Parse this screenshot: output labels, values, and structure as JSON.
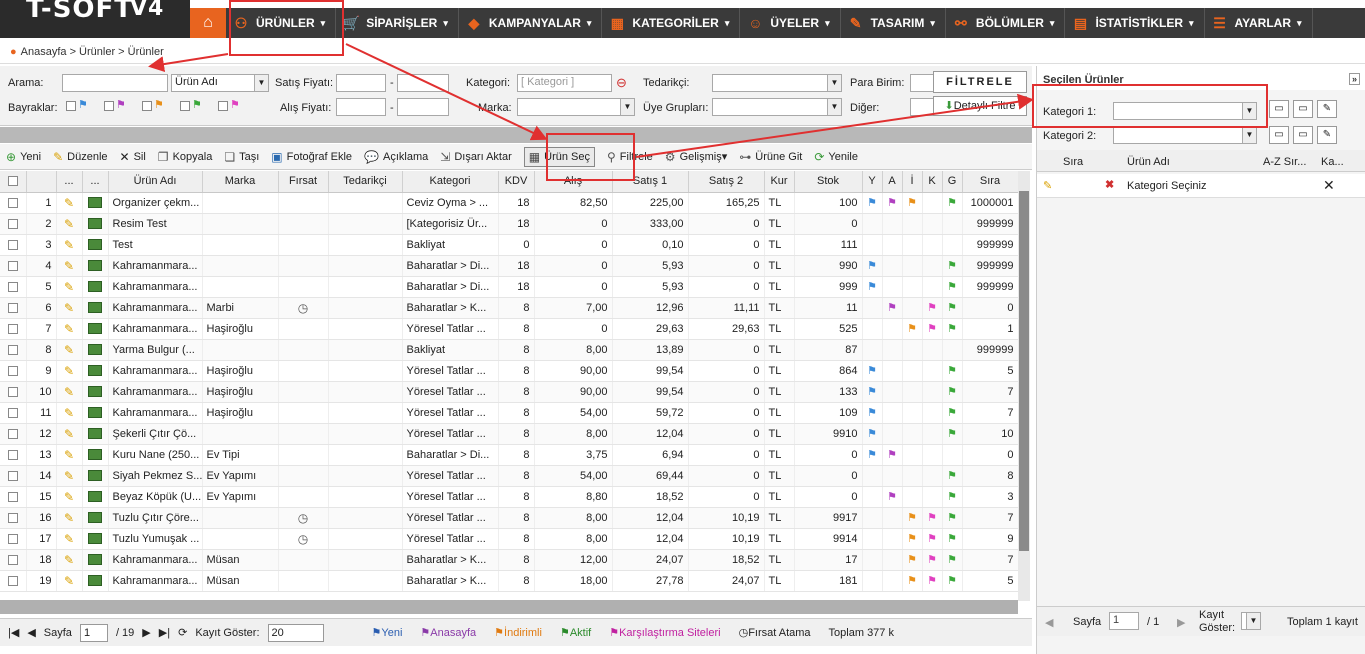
{
  "app": {
    "logo": "T-SOFT",
    "logo_version": "V4"
  },
  "menu": [
    {
      "label": "ÜRÜNLER",
      "icon": "product-icon"
    },
    {
      "label": "SİPARİŞLER",
      "icon": "cart-icon"
    },
    {
      "label": "KAMPANYALAR",
      "icon": "tag-icon"
    },
    {
      "label": "KATEGORİLER",
      "icon": "category-icon"
    },
    {
      "label": "ÜYELER",
      "icon": "users-icon"
    },
    {
      "label": "TASARIM",
      "icon": "design-icon"
    },
    {
      "label": "BÖLÜMLER",
      "icon": "sections-icon"
    },
    {
      "label": "İSTATİSTİKLER",
      "icon": "stats-icon"
    },
    {
      "label": "AYARLAR",
      "icon": "settings-icon"
    }
  ],
  "breadcrumb": "Anasayfa > Ürünler > Ürünler",
  "filters": {
    "arama": "Arama:",
    "urun_adi": "Ürün Adı",
    "satis_fiyati": "Satış Fiyatı:",
    "kategori": "Kategori:",
    "kategori_placeholder": "[ Kategori ]",
    "tedarikci": "Tedarikçi:",
    "para_birim": "Para Birim:",
    "filtrele": "FİLTRELE",
    "bayraklar": "Bayraklar:",
    "alis_fiyati": "Alış Fiyatı:",
    "marka": "Marka:",
    "uye_gruplari": "Üye Grupları:",
    "diger": "Diğer:",
    "detayli_filtre": "Detaylı Filtre",
    "dash": "-"
  },
  "toolbar": [
    "Yeni",
    "Düzenle",
    "Sil",
    "Kopyala",
    "Taşı",
    "Fotoğraf Ekle",
    "Açıklama",
    "Dışarı Aktar",
    "Ürün Seç",
    "Filtrele",
    "Gelişmiş",
    "Ürüne Git",
    "Yenile"
  ],
  "columns": [
    "...",
    "...",
    "Ürün Adı",
    "Marka",
    "Fırsat",
    "Tedarikçi",
    "Kategori",
    "KDV",
    "Alış",
    "Satış 1",
    "Satış 2",
    "Kur",
    "Stok",
    "Y",
    "A",
    "İ",
    "K",
    "G",
    "Sıra"
  ],
  "rows": [
    {
      "n": "1",
      "name": "Organizer çekm...",
      "brand": "",
      "firsat": false,
      "cat": "Ceviz Oyma > ...",
      "kdv": "18",
      "alis": "82,50",
      "s1": "225,00",
      "s2": "165,25",
      "kur": "TL",
      "stok": "100",
      "flags": [
        "Y",
        "A",
        "İ",
        "G"
      ],
      "sira": "1000001"
    },
    {
      "n": "2",
      "name": "Resim Test",
      "brand": "",
      "firsat": false,
      "cat": "[Kategorisiz Ür...",
      "kdv": "18",
      "alis": "0",
      "s1": "333,00",
      "s2": "0",
      "kur": "TL",
      "stok": "0",
      "flags": [],
      "sira": "999999"
    },
    {
      "n": "3",
      "name": "Test",
      "brand": "",
      "firsat": false,
      "cat": "Bakliyat",
      "kdv": "0",
      "alis": "0",
      "s1": "0,10",
      "s2": "0",
      "kur": "TL",
      "stok": "111",
      "flags": [],
      "sira": "999999"
    },
    {
      "n": "4",
      "name": "Kahramanmara...",
      "brand": "",
      "firsat": false,
      "cat": "Baharatlar > Di...",
      "kdv": "18",
      "alis": "0",
      "s1": "5,93",
      "s2": "0",
      "kur": "TL",
      "stok": "990",
      "flags": [
        "Y",
        "G"
      ],
      "sira": "999999"
    },
    {
      "n": "5",
      "name": "Kahramanmara...",
      "brand": "",
      "firsat": false,
      "cat": "Baharatlar > Di...",
      "kdv": "18",
      "alis": "0",
      "s1": "5,93",
      "s2": "0",
      "kur": "TL",
      "stok": "999",
      "flags": [
        "Y",
        "G"
      ],
      "sira": "999999"
    },
    {
      "n": "6",
      "name": "Kahramanmara...",
      "brand": "Marbi",
      "firsat": true,
      "cat": "Baharatlar > K...",
      "kdv": "8",
      "alis": "7,00",
      "s1": "12,96",
      "s2": "11,11",
      "kur": "TL",
      "stok": "11",
      "flags": [
        "A",
        "K",
        "G"
      ],
      "sira": "0"
    },
    {
      "n": "7",
      "name": "Kahramanmara...",
      "brand": "Haşiroğlu",
      "firsat": false,
      "cat": "Yöresel Tatlar ...",
      "kdv": "8",
      "alis": "0",
      "s1": "29,63",
      "s2": "29,63",
      "kur": "TL",
      "stok": "525",
      "flags": [
        "İ",
        "K",
        "G"
      ],
      "sira": "1"
    },
    {
      "n": "8",
      "name": "Yarma Bulgur (...",
      "brand": "",
      "firsat": false,
      "cat": "Bakliyat",
      "kdv": "8",
      "alis": "8,00",
      "s1": "13,89",
      "s2": "0",
      "kur": "TL",
      "stok": "87",
      "flags": [],
      "sira": "999999"
    },
    {
      "n": "9",
      "name": "Kahramanmara...",
      "brand": "Haşiroğlu",
      "firsat": false,
      "cat": "Yöresel Tatlar ...",
      "kdv": "8",
      "alis": "90,00",
      "s1": "99,54",
      "s2": "0",
      "kur": "TL",
      "stok": "864",
      "flags": [
        "Y",
        "G"
      ],
      "sira": "5"
    },
    {
      "n": "10",
      "name": "Kahramanmara...",
      "brand": "Haşiroğlu",
      "firsat": false,
      "cat": "Yöresel Tatlar ...",
      "kdv": "8",
      "alis": "90,00",
      "s1": "99,54",
      "s2": "0",
      "kur": "TL",
      "stok": "133",
      "flags": [
        "Y",
        "G"
      ],
      "sira": "7"
    },
    {
      "n": "11",
      "name": "Kahramanmara...",
      "brand": "Haşiroğlu",
      "firsat": false,
      "cat": "Yöresel Tatlar ...",
      "kdv": "8",
      "alis": "54,00",
      "s1": "59,72",
      "s2": "0",
      "kur": "TL",
      "stok": "109",
      "flags": [
        "Y",
        "G"
      ],
      "sira": "7"
    },
    {
      "n": "12",
      "name": "Şekerli Çıtır Çö...",
      "brand": "",
      "firsat": false,
      "cat": "Yöresel Tatlar ...",
      "kdv": "8",
      "alis": "8,00",
      "s1": "12,04",
      "s2": "0",
      "kur": "TL",
      "stok": "9910",
      "flags": [
        "Y",
        "G"
      ],
      "sira": "10"
    },
    {
      "n": "13",
      "name": "Kuru Nane (250...",
      "brand": "Ev Tipi",
      "firsat": false,
      "cat": "Baharatlar > Di...",
      "kdv": "8",
      "alis": "3,75",
      "s1": "6,94",
      "s2": "0",
      "kur": "TL",
      "stok": "0",
      "flags": [
        "Y",
        "A"
      ],
      "sira": "0"
    },
    {
      "n": "14",
      "name": "Siyah Pekmez S...",
      "brand": "Ev Yapımı",
      "firsat": false,
      "cat": "Yöresel Tatlar ...",
      "kdv": "8",
      "alis": "54,00",
      "s1": "69,44",
      "s2": "0",
      "kur": "TL",
      "stok": "0",
      "flags": [
        "G"
      ],
      "sira": "8"
    },
    {
      "n": "15",
      "name": "Beyaz Köpük (U...",
      "brand": "Ev Yapımı",
      "firsat": false,
      "cat": "Yöresel Tatlar ...",
      "kdv": "8",
      "alis": "8,80",
      "s1": "18,52",
      "s2": "0",
      "kur": "TL",
      "stok": "0",
      "flags": [
        "A",
        "G"
      ],
      "sira": "3"
    },
    {
      "n": "16",
      "name": "Tuzlu Çıtır Çöre...",
      "brand": "",
      "firsat": true,
      "cat": "Yöresel Tatlar ...",
      "kdv": "8",
      "alis": "8,00",
      "s1": "12,04",
      "s2": "10,19",
      "kur": "TL",
      "stok": "9917",
      "flags": [
        "İ",
        "K",
        "G"
      ],
      "sira": "7"
    },
    {
      "n": "17",
      "name": "Tuzlu Yumuşak ...",
      "brand": "",
      "firsat": true,
      "cat": "Yöresel Tatlar ...",
      "kdv": "8",
      "alis": "8,00",
      "s1": "12,04",
      "s2": "10,19",
      "kur": "TL",
      "stok": "9914",
      "flags": [
        "İ",
        "K",
        "G"
      ],
      "sira": "9"
    },
    {
      "n": "18",
      "name": "Kahramanmara...",
      "brand": "Müsan",
      "firsat": false,
      "cat": "Baharatlar > K...",
      "kdv": "8",
      "alis": "12,00",
      "s1": "24,07",
      "s2": "18,52",
      "kur": "TL",
      "stok": "17",
      "flags": [
        "İ",
        "K",
        "G"
      ],
      "sira": "7"
    },
    {
      "n": "19",
      "name": "Kahramanmara...",
      "brand": "Müsan",
      "firsat": false,
      "cat": "Baharatlar > K...",
      "kdv": "8",
      "alis": "18,00",
      "s1": "27,78",
      "s2": "24,07",
      "kur": "TL",
      "stok": "181",
      "flags": [
        "İ",
        "K",
        "G"
      ],
      "sira": "5"
    }
  ],
  "pager": {
    "sayfa": "Sayfa",
    "page": "1",
    "of": "/ 19",
    "kayit_goster": "Kayıt Göster:",
    "per_page": "20",
    "legend": [
      {
        "label": "Yeni",
        "color": "#2a5db0"
      },
      {
        "label": "Anasayfa",
        "color": "#8a3aa8"
      },
      {
        "label": "İndirimli",
        "color": "#e07a10"
      },
      {
        "label": "Aktif",
        "color": "#2a8a2a"
      },
      {
        "label": "Karşılaştırma Siteleri",
        "color": "#c020a0"
      },
      {
        "label": "Fırsat Atama",
        "color": "#222222"
      }
    ],
    "total": "Toplam 377 k"
  },
  "right": {
    "title": "Seçilen Ürünler",
    "kategori1": "Kategori 1:",
    "kategori2": "Kategori 2:",
    "col_sira": "Sıra",
    "col_urun": "Ürün Adı",
    "col_az": "A-Z Sır...",
    "col_ka": "Ka...",
    "row_text": "Kategori Seçiniz",
    "pager_sayfa": "Sayfa",
    "pager_page": "1",
    "pager_of": "/ 1",
    "pager_kayit": "Kayıt",
    "pager_goster": "Göster:",
    "pager_total": "Toplam 1 kayıt"
  },
  "colors": {
    "accent": "#e8641f",
    "annotation": "#e03030"
  }
}
